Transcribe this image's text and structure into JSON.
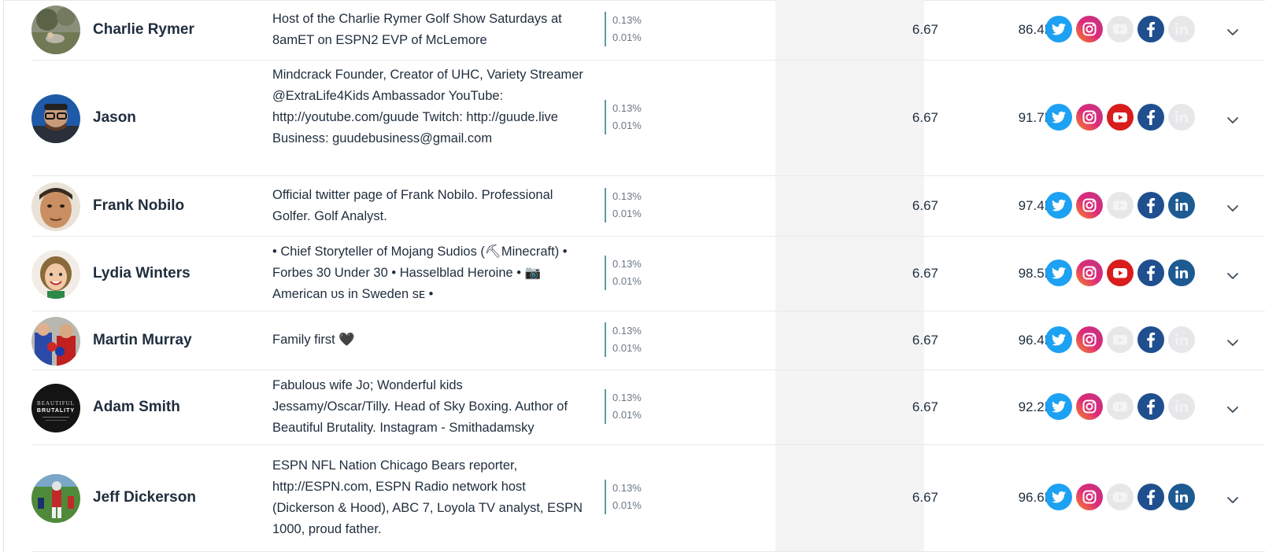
{
  "rows": [
    {
      "name": "Charlie Rymer",
      "bio": "Host of the Charlie Rymer Golf Show Saturdays at 8amET on ESPN2 EVP of McLemore",
      "engagement_top": "0.13%",
      "engagement_bottom": "0.01%",
      "score": "6.67",
      "followers": "86.4K",
      "socials": {
        "twitter": true,
        "instagram": true,
        "youtube": false,
        "facebook": true,
        "linkedin": false
      }
    },
    {
      "name": "Jason",
      "bio": "Mindcrack Founder, Creator of UHC, Variety Streamer @ExtraLife4Kids Ambassador YouTube: http://youtube.com/guude Twitch: http://guude.live Business: guudebusiness@gmail.com",
      "engagement_top": "0.13%",
      "engagement_bottom": "0.01%",
      "score": "6.67",
      "followers": "91.7K",
      "socials": {
        "twitter": true,
        "instagram": true,
        "youtube": true,
        "facebook": true,
        "linkedin": false
      }
    },
    {
      "name": "Frank Nobilo",
      "bio": "Official twitter page of Frank Nobilo. Professional Golfer. Golf Analyst.",
      "engagement_top": "0.13%",
      "engagement_bottom": "0.01%",
      "score": "6.67",
      "followers": "97.4K",
      "socials": {
        "twitter": true,
        "instagram": true,
        "youtube": false,
        "facebook": true,
        "linkedin": true
      }
    },
    {
      "name": "Lydia Winters",
      "bio": "• Chief Storyteller of Mojang Sudios (⛏Minecraft) • Forbes 30 Under 30 • Hasselblad Heroine • 📷 American ᴜs in Sweden sᴇ •",
      "engagement_top": "0.13%",
      "engagement_bottom": "0.01%",
      "score": "6.67",
      "followers": "98.5K",
      "socials": {
        "twitter": true,
        "instagram": true,
        "youtube": true,
        "facebook": true,
        "linkedin": true
      }
    },
    {
      "name": "Martin Murray",
      "bio": "Family first 🖤",
      "engagement_top": "0.13%",
      "engagement_bottom": "0.01%",
      "score": "6.67",
      "followers": "96.4K",
      "socials": {
        "twitter": true,
        "instagram": true,
        "youtube": false,
        "facebook": true,
        "linkedin": false
      }
    },
    {
      "name": "Adam Smith",
      "bio": "Fabulous wife Jo; Wonderful kids Jessamy/Oscar/Tilly. Head of Sky Boxing. Author of Beautiful Brutality. Instagram - Smithadamsky",
      "engagement_top": "0.13%",
      "engagement_bottom": "0.01%",
      "score": "6.67",
      "followers": "92.2K",
      "avatar_text": "BEAUTIFUL BRUTALITY",
      "socials": {
        "twitter": true,
        "instagram": true,
        "youtube": false,
        "facebook": true,
        "linkedin": false
      }
    },
    {
      "name": "Jeff Dickerson",
      "bio": "ESPN NFL Nation Chicago Bears reporter, http://ESPN.com, ESPN Radio network host (Dickerson & Hood), ABC 7, Loyola TV analyst, ESPN 1000, proud father.",
      "engagement_top": "0.13%",
      "engagement_bottom": "0.01%",
      "score": "6.67",
      "followers": "96.6K",
      "socials": {
        "twitter": true,
        "instagram": true,
        "youtube": false,
        "facebook": true,
        "linkedin": true
      }
    }
  ],
  "colors": {
    "twitter": "#1da1f2",
    "instagram_from": "#f58529",
    "instagram_to": "#c13584",
    "youtube": "#d91c1c",
    "facebook": "#1f4f8f",
    "linkedin": "#1d5a92",
    "inactive": "#e6e7e9",
    "engagement_bar": "#5e9aa3"
  },
  "icons": [
    "twitter-icon",
    "instagram-icon",
    "youtube-icon",
    "facebook-icon",
    "linkedin-icon",
    "chevron-down-icon"
  ]
}
